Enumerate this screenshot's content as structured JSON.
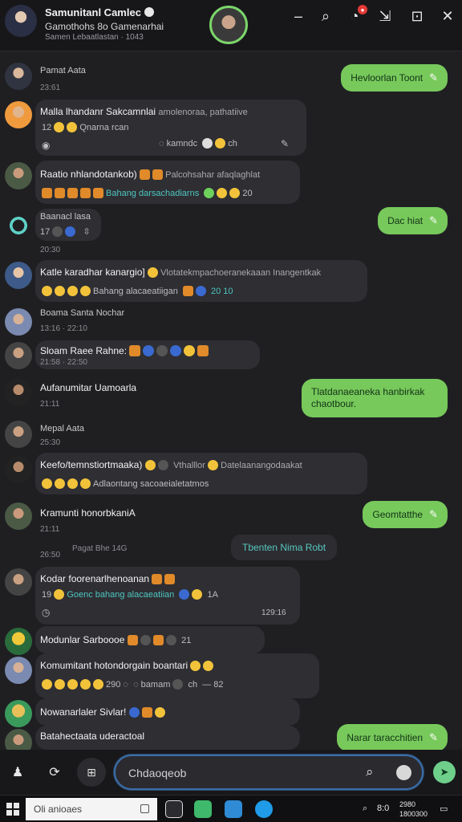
{
  "header": {
    "title": "Samunitanl Camlec",
    "subtitle": "Gamothohs 8o Gamenarhai",
    "meta": "Samen Lebaatlastan · 1043"
  },
  "messages": [
    {
      "type": "in",
      "name": "Pamat Aata",
      "time": "23:61"
    },
    {
      "type": "out",
      "text": "Hevloorlan Toont"
    },
    {
      "type": "in",
      "name": "Malla lhandanr Sakcamnlai",
      "extra": "amolenoraa, pathatiive",
      "line2_a": "12",
      "line2_b": "Qnarna rcan",
      "line3_a": "kamndc",
      "line3_b": "ch"
    },
    {
      "type": "in",
      "name": "Raatio nhlandotankob)",
      "extra": "Palcohsahar afaqlaghlat",
      "line2": "Bahang darsachadiarns",
      "count": "20"
    },
    {
      "type": "out",
      "text": "Dac hiat"
    },
    {
      "type": "in",
      "name": "Baanacl lasa",
      "line2": "17",
      "time": "20:30"
    },
    {
      "type": "in",
      "name": "Katle karadhar kanargio]",
      "extra": "Vlotatekmpachoeranekaaan Inangentkak",
      "line2": "Bahang alacaeatiigan",
      "count": "20 10"
    },
    {
      "type": "in",
      "name": "Boama Santa Nochar",
      "time": "13:16 · 22:10"
    },
    {
      "type": "in",
      "name": "Sloam Raee Rahne:",
      "time": "21:58 · 22:50"
    },
    {
      "type": "in",
      "name": "Aufanumitar Uamoarla",
      "time": "21:11"
    },
    {
      "type": "out",
      "text": "Tlatdanaeaneka hanbirkak chaotbour."
    },
    {
      "type": "in",
      "name": "Mepal Aata",
      "time": "25:30"
    },
    {
      "type": "in",
      "name": "Keefo/temnstiortmaaka)",
      "extra": "Vthalllor",
      "extra2": "Datelaanangodaakat",
      "line2": "Adlaontang sacoaeialetatmos"
    },
    {
      "type": "out",
      "text": "Geomtatthe"
    },
    {
      "type": "in",
      "name": "Kramunti honorbkaniA",
      "time": "21:11"
    },
    {
      "type": "sys",
      "text": "Tbenten Nima Robt",
      "caption": "Pagat Bhe 14G",
      "time": "26:50"
    },
    {
      "type": "in",
      "name": "Kodar foorenarlhenoanan",
      "line2_a": "19",
      "line2_b": "Goenc bahang alacaeatiian",
      "count": "1A",
      "time2": "129:16"
    },
    {
      "type": "in",
      "name": "Modunlar Sarboooe",
      "count": "21"
    },
    {
      "type": "in",
      "name": "Komumitant hotondorgain boantari",
      "line2": "290",
      "line2_b": "bamam",
      "line2_c": "ch",
      "count": "82"
    },
    {
      "type": "in",
      "name": "Nowanarlaler Sivlar!"
    },
    {
      "type": "in",
      "name": "Batahectaata uderactoal"
    },
    {
      "type": "out",
      "text": "Narar taracchitien"
    }
  ],
  "composer": {
    "placeholder": "Chdaoqeob"
  },
  "taskbar": {
    "search": "Oli anioaes",
    "time": "2980",
    "date": "1800300",
    "label": "8:0"
  }
}
